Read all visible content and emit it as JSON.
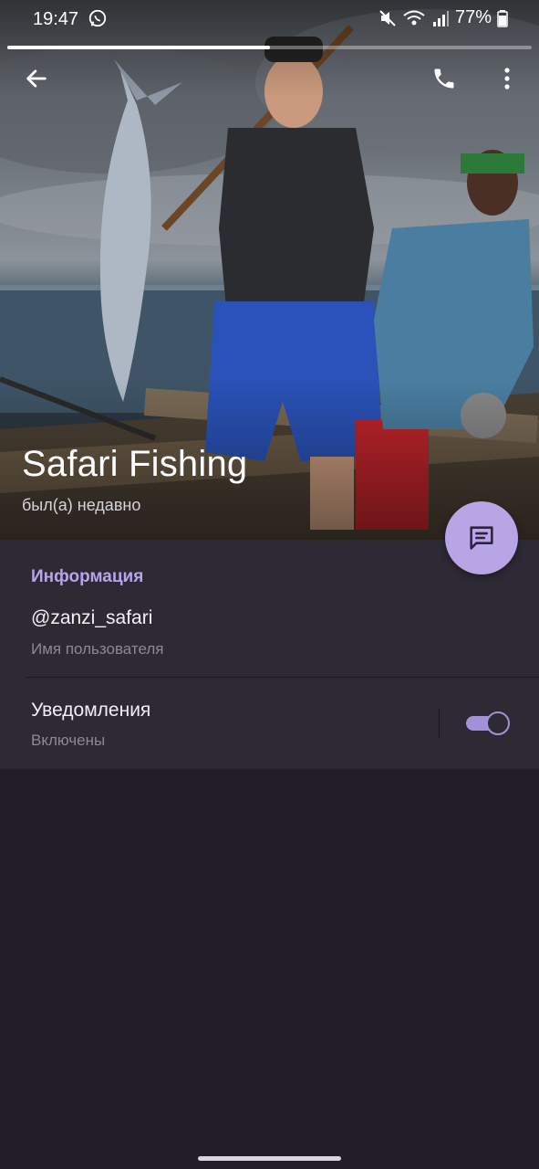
{
  "status_bar": {
    "time": "19:47",
    "battery": "77%",
    "icons": [
      "whatsapp-icon",
      "mute-icon",
      "wifi-icon",
      "signal-icon",
      "battery-icon"
    ]
  },
  "story_progress": 0.5,
  "toolbar": {
    "back_icon": "arrow-left-icon",
    "call_icon": "phone-icon",
    "more_icon": "more-vertical-icon"
  },
  "profile": {
    "name": "Safari Fishing",
    "last_seen": "был(а) недавно"
  },
  "fab": {
    "icon": "message-icon"
  },
  "info": {
    "header": "Информация",
    "username": "@zanzi_safari",
    "username_caption": "Имя пользователя",
    "notifications_label": "Уведомления",
    "notifications_state": "Включены",
    "notifications_on": true
  },
  "colors": {
    "accent": "#b9a3ec",
    "fab": "#b7a5e6",
    "panel": "#2d2a34",
    "background": "#211e28"
  }
}
